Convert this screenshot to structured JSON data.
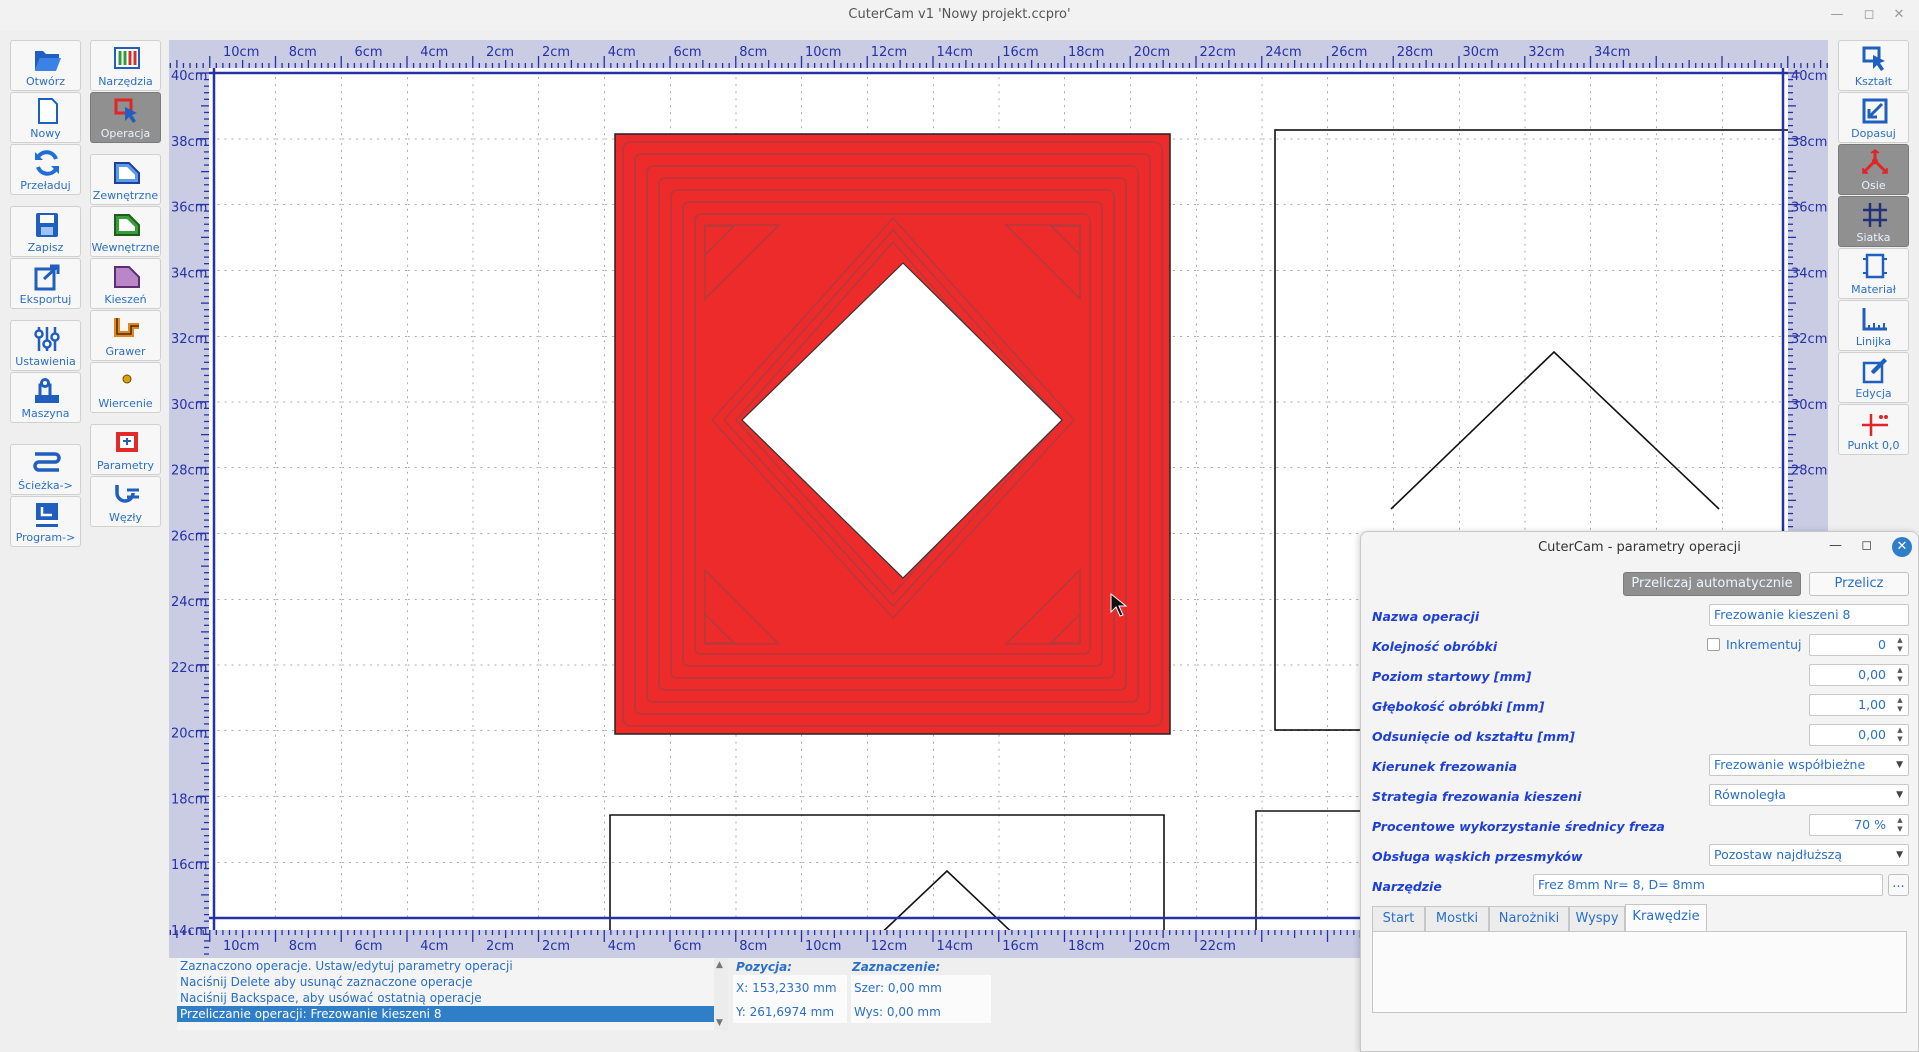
{
  "window": {
    "title": "CuterCam v1 'Nowy projekt.ccpro'",
    "controls": [
      "—",
      "◻",
      "✕"
    ]
  },
  "left_toolbar": [
    {
      "label": "Otwórz",
      "icon": "folder-open-icon",
      "active": false
    },
    {
      "label": "Nowy",
      "icon": "new-file-icon",
      "active": false
    },
    {
      "label": "Przeładuj",
      "icon": "reload-icon",
      "active": false
    },
    {
      "label": "Zapisz",
      "icon": "save-icon",
      "active": false
    },
    {
      "label": "Eksportuj",
      "icon": "export-icon",
      "active": false
    },
    {
      "label": "Ustawienia",
      "icon": "settings-sliders-icon",
      "active": false
    },
    {
      "label": "Maszyna",
      "icon": "machine-icon",
      "active": false
    },
    {
      "label": "Ścieżka->",
      "icon": "path-icon",
      "active": false
    },
    {
      "label": "Program->",
      "icon": "gcode-program-icon",
      "active": false
    }
  ],
  "op_toolbar": [
    {
      "label": "Narzędzia",
      "icon": "tools-icon",
      "active": false
    },
    {
      "label": "Operacja",
      "icon": "operation-cursor-icon",
      "active": true
    },
    {
      "label": "Zewnętrzne",
      "icon": "outer-contour-icon",
      "active": false
    },
    {
      "label": "Wewnętrzne",
      "icon": "inner-contour-icon",
      "active": false
    },
    {
      "label": "Kieszeń",
      "icon": "pocket-icon",
      "active": false
    },
    {
      "label": "Grawer",
      "icon": "engrave-icon",
      "active": false
    },
    {
      "label": "Wiercenie",
      "icon": "drilling-icon",
      "active": false
    },
    {
      "label": "Parametry",
      "icon": "parameters-icon",
      "active": false
    },
    {
      "label": "Węzły",
      "icon": "nodes-icon",
      "active": false
    }
  ],
  "right_toolbar": [
    {
      "label": "Kształt",
      "icon": "shape-select-icon",
      "active": false
    },
    {
      "label": "Dopasuj",
      "icon": "fit-icon",
      "active": false
    },
    {
      "label": "Osie",
      "icon": "axes-icon",
      "active": true
    },
    {
      "label": "Siatka",
      "icon": "grid-icon",
      "active": true
    },
    {
      "label": "Materiał",
      "icon": "material-icon",
      "active": false
    },
    {
      "label": "Linijka",
      "icon": "ruler-icon",
      "active": false
    },
    {
      "label": "Edycja",
      "icon": "edit-icon",
      "active": false
    },
    {
      "label": "Punkt 0,0",
      "icon": "origin-point-icon",
      "active": false
    }
  ],
  "canvas": {
    "top_ruler": [
      "10cm",
      "8cm",
      "6cm",
      "4cm",
      "2cm",
      "2cm",
      "4cm",
      "6cm",
      "8cm",
      "10cm",
      "12cm",
      "14cm",
      "16cm",
      "18cm",
      "20cm",
      "22cm",
      "24cm",
      "26cm",
      "28cm",
      "30cm",
      "32cm",
      "34cm"
    ],
    "bottom_ruler": [
      "10cm",
      "8cm",
      "6cm",
      "4cm",
      "2cm",
      "2cm",
      "4cm",
      "6cm",
      "8cm",
      "10cm",
      "12cm",
      "14cm",
      "16cm",
      "18cm",
      "20cm",
      "22cm"
    ],
    "left_ruler": [
      "40cm",
      "38cm",
      "36cm",
      "34cm",
      "32cm",
      "30cm",
      "28cm",
      "26cm",
      "24cm",
      "22cm",
      "20cm",
      "18cm",
      "16cm",
      "14cm"
    ],
    "right_ruler": [
      "40cm",
      "38cm",
      "36cm",
      "34cm",
      "32cm",
      "30cm",
      "28cm"
    ],
    "pocket_color": "#ee2b2b",
    "toolpath_color": "#b53a3a"
  },
  "messages": [
    "Zaznaczono operacje. Ustaw/edytuj parametry operacji",
    "Naciśnij Delete aby usunąć zaznaczone operacje",
    "Naciśnij Backspace, aby usówać ostatnią operacje",
    "Przeliczanie operacji: Frezowanie kieszeni 8"
  ],
  "position": {
    "label": "Pozycja:",
    "x": "X: 153,2330 mm",
    "y": "Y: 261,6974 mm"
  },
  "selection": {
    "label": "Zaznaczenie:",
    "width": "Szer: 0,00 mm",
    "height": "Wys: 0,00 mm"
  },
  "dialog": {
    "title": "CuterCam - parametry operacji",
    "auto_button": "Przeliczaj automatycznie",
    "recalc_button": "Przelicz",
    "params": {
      "name_label": "Nazwa operacji",
      "name_value": "Frezowanie kieszeni 8",
      "order_label": "Kolejność obróbki",
      "incremental_label": "Inkrementuj",
      "order_value": "0",
      "start_label": "Poziom startowy [mm]",
      "start_value": "0,00",
      "depth_label": "Głębokość obróbki [mm]",
      "depth_value": "1,00",
      "offset_label": "Odsunięcie od kształtu [mm]",
      "offset_value": "0,00",
      "direction_label": "Kierunek frezowania",
      "direction_value": "Frezowanie współbieżne",
      "strategy_label": "Strategia frezowania kieszeni",
      "strategy_value": "Równoległa",
      "percent_label": "Procentowe wykorzystanie średnicy freza",
      "percent_value": "70 %",
      "narrow_label": "Obsługa wąskich przesmyków",
      "narrow_value": "Pozostaw najdłuższą",
      "tool_label": "Narzędzie",
      "tool_value": "Frez 8mm Nr= 8, D= 8mm",
      "tool_button": "..."
    },
    "tabs": [
      "Start",
      "Mostki",
      "Narożniki",
      "Wyspy",
      "Krawędzie"
    ],
    "active_tab": "Krawędzie"
  }
}
